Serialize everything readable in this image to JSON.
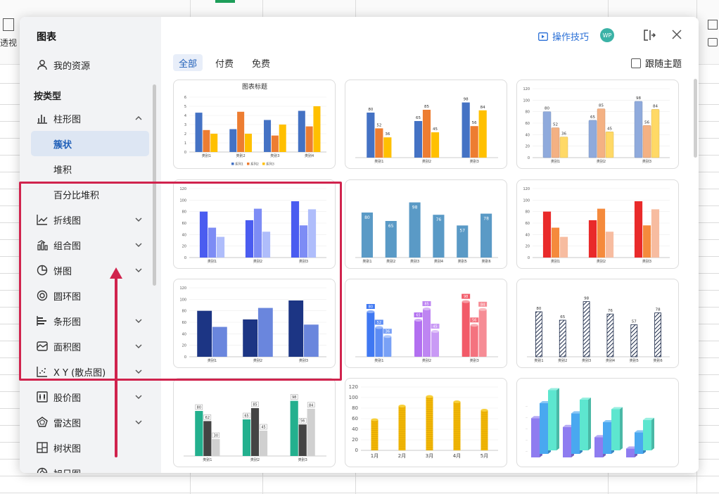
{
  "background": {
    "ribbon_label": "透视"
  },
  "dialog": {
    "title": "图表",
    "my_resources": "我的资源",
    "section_label": "按类型",
    "nav": [
      {
        "name": "bar",
        "label": "柱形图",
        "icon": "bar-chart-icon",
        "expanded": true,
        "children": [
          {
            "label": "簇状",
            "active": true
          },
          {
            "label": "堆积"
          },
          {
            "label": "百分比堆积"
          }
        ]
      },
      {
        "name": "line",
        "label": "折线图",
        "icon": "line-chart-icon"
      },
      {
        "name": "combo",
        "label": "组合图",
        "icon": "combo-chart-icon"
      },
      {
        "name": "pie",
        "label": "饼图",
        "icon": "pie-chart-icon"
      },
      {
        "name": "doughnut",
        "label": "圆环图",
        "icon": "doughnut-chart-icon"
      },
      {
        "name": "hbar",
        "label": "条形图",
        "icon": "horizontal-bar-icon"
      },
      {
        "name": "area",
        "label": "面积图",
        "icon": "area-chart-icon"
      },
      {
        "name": "scatter",
        "label": "X Y (散点图)",
        "icon": "scatter-chart-icon"
      },
      {
        "name": "stock",
        "label": "股价图",
        "icon": "stock-chart-icon"
      },
      {
        "name": "radar",
        "label": "雷达图",
        "icon": "radar-chart-icon"
      },
      {
        "name": "treemap",
        "label": "树状图",
        "icon": "treemap-icon"
      },
      {
        "name": "sunburst",
        "label": "旭日图",
        "icon": "sunburst-icon"
      }
    ],
    "header": {
      "tips_label": "操作技巧",
      "avatar_initials": "WP"
    },
    "tabs": [
      {
        "label": "全部",
        "active": true
      },
      {
        "label": "付费"
      },
      {
        "label": "免费"
      }
    ],
    "follow_theme_label": "跟随主题"
  },
  "chart_data": [
    {
      "type": "bar",
      "title": "图表标题",
      "categories": [
        "类别1",
        "类别2",
        "类别3",
        "类别4"
      ],
      "series": [
        {
          "name": "系列1",
          "values": [
            4.3,
            2.5,
            3.5,
            4.5
          ]
        },
        {
          "name": "系列2",
          "values": [
            2.4,
            4.4,
            1.8,
            2.8
          ]
        },
        {
          "name": "系列3",
          "values": [
            2.0,
            2.0,
            3.0,
            5.0
          ]
        }
      ],
      "yticks": [
        "0",
        "1",
        "2",
        "3",
        "4",
        "5",
        "6"
      ],
      "ylim": [
        0,
        6
      ],
      "colors": [
        "#4472c4",
        "#ed7d31",
        "#ffc000"
      ],
      "legend": "bottom"
    },
    {
      "type": "bar",
      "categories": [
        "类别1",
        "类别2",
        "类别3"
      ],
      "series": [
        {
          "values": [
            80,
            65,
            98
          ]
        },
        {
          "values": [
            52,
            85,
            56
          ]
        },
        {
          "values": [
            36,
            45,
            84
          ]
        }
      ],
      "ylim": [
        0,
        120
      ],
      "data_labels": true,
      "colors": [
        "#4472c4",
        "#ed7d31",
        "#ffc000"
      ]
    },
    {
      "type": "bar",
      "categories": [
        "类别1",
        "类别2",
        "类别3"
      ],
      "series": [
        {
          "values": [
            80,
            65,
            98
          ]
        },
        {
          "values": [
            52,
            85,
            56
          ]
        },
        {
          "values": [
            36,
            45,
            84
          ]
        }
      ],
      "yticks": [
        "0",
        "20",
        "40",
        "60",
        "80",
        "100",
        "120"
      ],
      "ylim": [
        0,
        120
      ],
      "data_labels": true,
      "gradient": true,
      "colors": [
        "#8faadc",
        "#f4b183",
        "#ffd966"
      ]
    },
    {
      "type": "bar",
      "categories": [
        "类别1",
        "类别2",
        "类别3"
      ],
      "series": [
        {
          "values": [
            80,
            65,
            98
          ]
        },
        {
          "values": [
            52,
            85,
            56
          ]
        },
        {
          "values": [
            36,
            45,
            84
          ]
        }
      ],
      "yticks": [
        "0",
        "20",
        "40",
        "60",
        "80",
        "100",
        "120"
      ],
      "ylim": [
        0,
        120
      ],
      "colors": [
        "#4a5cf0",
        "#7d8cf5",
        "#afbdfb"
      ]
    },
    {
      "type": "bar",
      "categories": [
        "类别1",
        "类别2",
        "类别3",
        "类别4",
        "类别5",
        "类别6"
      ],
      "series": [
        {
          "values": [
            80,
            65,
            98,
            76,
            57,
            78
          ]
        }
      ],
      "ylim": [
        0,
        120
      ],
      "data_labels": true,
      "labels_inside": true,
      "colors": [
        "#5a9ac6"
      ]
    },
    {
      "type": "bar",
      "categories": [
        "类别1",
        "类别2",
        "类别3"
      ],
      "series": [
        {
          "values": [
            80,
            65,
            98
          ]
        },
        {
          "values": [
            52,
            85,
            56
          ]
        },
        {
          "values": [
            36,
            45,
            84
          ]
        }
      ],
      "yticks": [
        "0",
        "20",
        "40",
        "60",
        "80",
        "100",
        "120"
      ],
      "ylim": [
        0,
        120
      ],
      "colors": [
        "#e92a2a",
        "#f58a3c",
        "#f7bca0"
      ]
    },
    {
      "type": "bar",
      "categories": [
        "类别1",
        "类别2",
        "类别3"
      ],
      "series": [
        {
          "values": [
            80,
            65,
            98
          ]
        },
        {
          "values": [
            52,
            85,
            56
          ]
        }
      ],
      "yticks": [
        "0",
        "20",
        "40",
        "60",
        "80",
        "100",
        "120"
      ],
      "ylim": [
        0,
        120
      ],
      "colors": [
        "#1c3584",
        "#6a86dd"
      ]
    },
    {
      "type": "bar",
      "style": "cylinder",
      "categories": [
        "类别1",
        "类别2",
        "类别3"
      ],
      "series": [
        {
          "values": [
            80,
            65,
            98
          ]
        },
        {
          "values": [
            52,
            85,
            56
          ]
        },
        {
          "values": [
            36,
            45,
            84
          ]
        }
      ],
      "ylim": [
        0,
        120
      ],
      "data_labels": true,
      "group_colors": [
        "#3f78f2",
        "#b26ff0",
        "#f25a68"
      ]
    },
    {
      "type": "bar",
      "style": "hatched",
      "categories": [
        "类别1",
        "类别2",
        "类别3",
        "类别4",
        "类别5",
        "类别6"
      ],
      "series": [
        {
          "values": [
            80,
            65,
            98,
            76,
            57,
            78
          ]
        }
      ],
      "ylim": [
        0,
        120
      ],
      "data_labels": true,
      "colors": [
        "#1d2b4a"
      ]
    },
    {
      "type": "bar",
      "categories": [
        "类别1",
        "类别2",
        "类别3"
      ],
      "series": [
        {
          "values": [
            80,
            65,
            98
          ]
        },
        {
          "values": [
            62,
            85,
            56
          ]
        },
        {
          "values": [
            30,
            45,
            84
          ]
        }
      ],
      "ylim": [
        0,
        120
      ],
      "data_labels": true,
      "colors": [
        "#23b08e",
        "#444444",
        "#d0d0d0"
      ]
    },
    {
      "type": "bar",
      "style": "coin-stack",
      "categories": [
        "1月",
        "2月",
        "3月",
        "4月",
        "5月"
      ],
      "series": [
        {
          "values": [
            58,
            84,
            102,
            92,
            76
          ]
        }
      ],
      "yticks": [
        "0",
        "20",
        "40",
        "60",
        "80",
        "100",
        "120"
      ],
      "ylim": [
        0,
        120
      ],
      "colors": [
        "#f2b705"
      ]
    },
    {
      "type": "bar",
      "style": "3d-clustered",
      "categories": [
        "",
        "",
        "",
        ""
      ],
      "series": [
        {
          "values": [
            62,
            48,
            32,
            14
          ]
        },
        {
          "values": [
            80,
            64,
            50,
            34
          ]
        },
        {
          "values": [
            95,
            80,
            65,
            48
          ]
        }
      ],
      "ylim": [
        0,
        100
      ],
      "colors": [
        "#8e7cf0",
        "#49a8f0",
        "#5de6cf"
      ]
    }
  ]
}
